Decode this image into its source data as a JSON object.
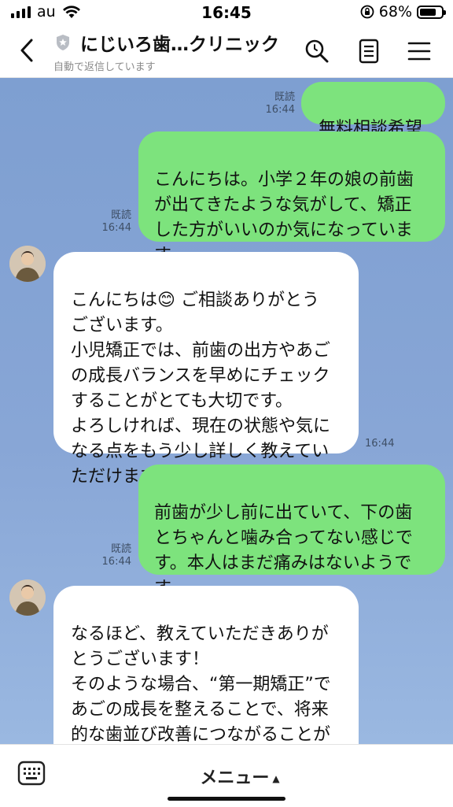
{
  "status": {
    "carrier": "au",
    "time": "16:45",
    "battery": "68%",
    "battery_level": 0.68
  },
  "header": {
    "title": "にじいろ歯…クリニック",
    "subtitle": "自動で返信しています",
    "icons": [
      "back-icon",
      "shield-icon",
      "search-icon",
      "notes-icon",
      "menu-icon"
    ]
  },
  "messages": [
    {
      "dir": "out",
      "text": "無料相談希望",
      "read": "既読",
      "time": "16:44"
    },
    {
      "dir": "out",
      "text": "こんにちは。小学２年の娘の前歯\nが出てきたような気がして、矯正\nした方がいいのか気になっていま\nす。",
      "read": "既読",
      "time": "16:44"
    },
    {
      "dir": "in",
      "text_before_emoji": "こんにちは",
      "emoji": "😊",
      "text_after_emoji": " ご相談ありがとう\nございます。\n小児矯正では、前歯の出方やあご\nの成長バランスを早めにチェック\nすることがとても大切です。\nよろしければ、現在の状態や気に\nなる点をもう少し詳しく教えてい\nただけますか？",
      "time": "16:44"
    },
    {
      "dir": "out",
      "text": "前歯が少し前に出ていて、下の歯\nとちゃんと噛み合ってない感じで\nす。本人はまだ痛みはないようで\nす。",
      "read": "既読",
      "time": "16:44"
    },
    {
      "dir": "in",
      "text": "なるほど、教えていただきありが\nとうございます！\nそのような場合、“第一期矯正”で\nあごの成長を整えることで、将来\n的な歯並び改善につながることが\nあります。\n無料相談でお口の状態を拝見しな"
    }
  ],
  "bottom": {
    "menu_label": "メニュー",
    "menu_arrow": "▲"
  },
  "colors": {
    "chat_bg": "#86a4d5",
    "outgoing": "#7de37d",
    "incoming": "#ffffff"
  }
}
